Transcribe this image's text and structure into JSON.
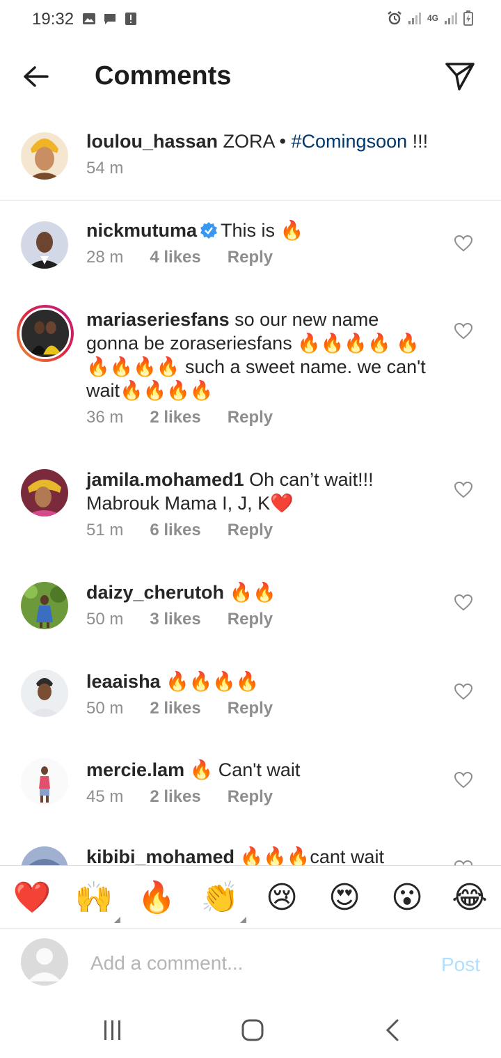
{
  "status_bar": {
    "time": "19:32",
    "left_icons": [
      "image-icon",
      "chat-icon",
      "alert-icon"
    ],
    "right_icons": [
      "alarm-icon",
      "signal-icon",
      "4g-icon",
      "signal-icon",
      "battery-icon"
    ],
    "network": "4G"
  },
  "header": {
    "title": "Comments",
    "back_icon": "arrow-left-icon",
    "send_icon": "paper-plane-icon"
  },
  "caption": {
    "username": "loulou_hassan",
    "text": " ZORA • ",
    "hashtag": "#Comingsoon",
    "suffix": " !!!",
    "time": "54 m"
  },
  "comments": [
    {
      "username": "nickmutuma",
      "verified": true,
      "text": "This is 🔥",
      "time": "28 m",
      "likes": "4 likes",
      "reply": "Reply"
    },
    {
      "username": "mariaseriesfans",
      "text": " so our new name gonna be zoraseriesfans 🔥🔥🔥🔥 🔥🔥🔥🔥🔥 such a sweet name. we can't wait🔥🔥🔥🔥",
      "time": "36 m",
      "likes": "2 likes",
      "reply": "Reply"
    },
    {
      "username": "jamila.mohamed1",
      "text": " Oh can’t wait!!! Mabrouk Mama I, J, K❤️",
      "time": "51 m",
      "likes": "6 likes",
      "reply": "Reply"
    },
    {
      "username": "daizy_cherutoh",
      "text": " 🔥🔥",
      "time": "50 m",
      "likes": "3 likes",
      "reply": "Reply"
    },
    {
      "username": "leaaisha",
      "text": " 🔥🔥🔥🔥",
      "time": "50 m",
      "likes": "2 likes",
      "reply": "Reply"
    },
    {
      "username": "mercie.lam",
      "text": " 🔥 Can't wait",
      "time": "45 m",
      "likes": "2 likes",
      "reply": "Reply"
    },
    {
      "username": "kibibi_mohamed",
      "text": " 🔥🔥🔥cant wait"
    }
  ],
  "emoji_bar": [
    "❤️",
    "🙌",
    "🔥",
    "👏",
    "😢",
    "😍",
    "😮",
    "😂"
  ],
  "input": {
    "placeholder": "Add a comment...",
    "post_label": "Post"
  },
  "nav": [
    "recents-icon",
    "home-icon",
    "back-icon"
  ]
}
